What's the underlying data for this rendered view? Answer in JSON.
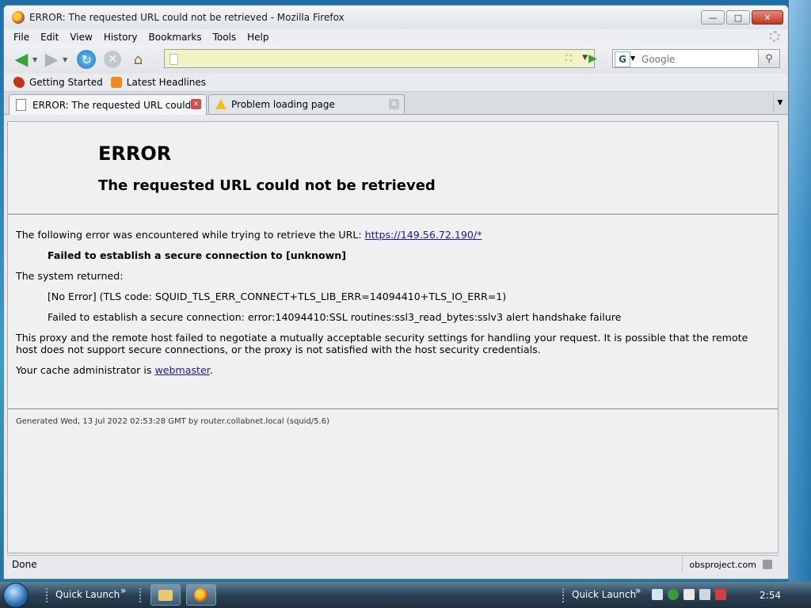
{
  "window": {
    "title": "ERROR: The requested URL could not be retrieved - Mozilla Firefox",
    "buttons": {
      "minimize": "—",
      "maximize": "□",
      "close": "✕"
    }
  },
  "menu": [
    "File",
    "Edit",
    "View",
    "History",
    "Bookmarks",
    "Tools",
    "Help"
  ],
  "navigation": {
    "url_value": "",
    "search_placeholder": "Google",
    "search_engine_letter": "G"
  },
  "bookmarks": [
    {
      "label": "Getting Started",
      "icon": "firefox-icon"
    },
    {
      "label": "Latest Headlines",
      "icon": "rss-icon"
    }
  ],
  "tabs": [
    {
      "label": "ERROR: The requested URL could...",
      "active": true,
      "icon": "page-icon"
    },
    {
      "label": "Problem loading page",
      "active": false,
      "icon": "warning-icon"
    }
  ],
  "page": {
    "heading": "ERROR",
    "subheading": "The requested URL could not be retrieved",
    "intro_text": "The following error was encountered while trying to retrieve the URL: ",
    "url_link": "https://149.56.72.190/*",
    "failure_bold": "Failed to establish a secure connection to [unknown]",
    "system_returned": "The system returned:",
    "error_code": "[No Error] (TLS code: SQUID_TLS_ERR_CONNECT+TLS_LIB_ERR=14094410+TLS_IO_ERR=1)",
    "error_detail": "Failed to establish a secure connection: error:14094410:SSL routines:ssl3_read_bytes:sslv3 alert handshake failure",
    "explanation": "This proxy and the remote host failed to negotiate a mutually acceptable security settings for handling your request. It is possible that the remote host does not support secure connections, or the proxy is not satisfied with the host security credentials.",
    "admin_text": "Your cache administrator is ",
    "admin_link": "webmaster",
    "admin_period": ".",
    "footer": "Generated Wed, 13 Jul 2022 02:53:28 GMT by router.collabnet.local (squid/5.6)"
  },
  "status": {
    "text": "Done",
    "domain": "obsproject.com"
  },
  "taskbar": {
    "quick_launch_left": "Quick Launch",
    "quick_launch_right": "Quick Launch",
    "clock": "2:54"
  },
  "colors": {
    "link": "#1a1aa8",
    "url_bar_bg": "#f4f3c6",
    "close_button": "#c2351d"
  }
}
